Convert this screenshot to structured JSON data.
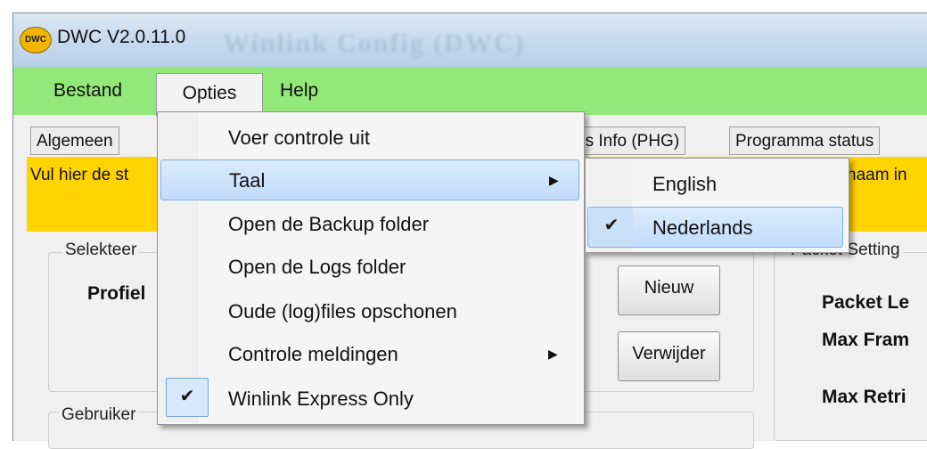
{
  "window": {
    "title": "DWC V2.0.11.0",
    "icon_text": "DWC",
    "background_title": "Winlink Config (DWC)"
  },
  "menubar": {
    "items": [
      "Bestand",
      "Opties",
      "Help"
    ],
    "background_color": "#92e878"
  },
  "tabs": {
    "left": "Algemeen",
    "partial": "ns Info (PHG)",
    "right": "Programma status"
  },
  "banner": {
    "left_text": "Vul hier de st",
    "right_text": "naam in",
    "color": "#ffd400"
  },
  "profile_group": {
    "legend": "Selekteer",
    "label": "Profiel"
  },
  "buttons": {
    "new": "Nieuw",
    "delete": "Verwijder"
  },
  "users_group": {
    "legend": "Gebruiker"
  },
  "packet_group": {
    "legend": "Packet Setting",
    "labels": [
      "Packet Le",
      "Max Fram",
      "Max Retri"
    ]
  },
  "opties_menu": {
    "items": [
      {
        "label": "Voer controle uit",
        "has_submenu": false,
        "checked": false
      },
      {
        "label": "Taal",
        "has_submenu": true,
        "checked": false,
        "highlighted": true
      },
      {
        "label": "Open de Backup folder",
        "has_submenu": false,
        "checked": false
      },
      {
        "label": "Open de Logs folder",
        "has_submenu": false,
        "checked": false
      },
      {
        "label": "Oude (log)files opschonen",
        "has_submenu": false,
        "checked": false
      },
      {
        "label": "Controle meldingen",
        "has_submenu": true,
        "checked": false
      },
      {
        "label": "Winlink Express Only",
        "has_submenu": false,
        "checked": true
      }
    ]
  },
  "taal_submenu": {
    "items": [
      {
        "label": "English",
        "checked": false
      },
      {
        "label": "Nederlands",
        "checked": true,
        "highlighted": true
      }
    ]
  },
  "icons": {
    "check": "✔",
    "submenu_arrow": "▶"
  }
}
